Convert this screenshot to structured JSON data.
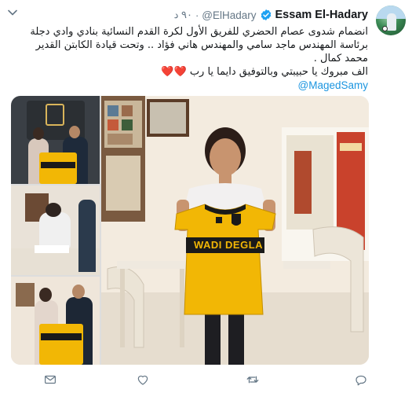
{
  "tweet": {
    "author_name": "Essam El-Hadary",
    "author_handle": "@ElHadary",
    "time": "٩٠ د",
    "separator": "·",
    "text_line1": "انضمام شدوى عصام الحضري للفريق الأول لكرة القدم النسائية بنادي وادي دجلة برئاسة المهندس ماجد سامي والمهندس هاني فؤاد .. وتحت قيادة الكابتن القدير محمد كمال .",
    "text_line2": "الف مبروك يا حبيبتي وبالتوفيق دايما يا رب",
    "hearts": "❤️❤️",
    "mention": "@MagedSamy",
    "jersey_text": "WADI DEGLA",
    "colors": {
      "link": "#1b95e0",
      "secondary": "#657786",
      "jersey": "#f2b705",
      "verified": "#1da1f2"
    }
  },
  "icons": {
    "verified": "verified-badge-icon",
    "caret": "chevron-down-icon",
    "reply": "reply-icon",
    "retweet": "retweet-icon",
    "like": "heart-icon",
    "message": "envelope-icon"
  }
}
